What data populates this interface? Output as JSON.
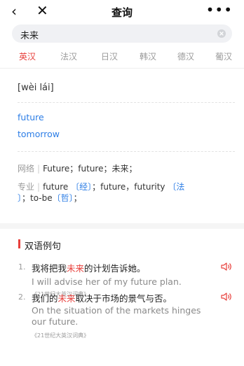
{
  "nav": {
    "back_glyph": "‹",
    "close_glyph": "✕",
    "title": "查询",
    "more_glyph": "•••"
  },
  "search": {
    "value": "未来"
  },
  "tabs": [
    "英汉",
    "法汉",
    "日汉",
    "韩汉",
    "德汉",
    "葡汉"
  ],
  "active_tab": 0,
  "entry": {
    "phonetic": "[wèi lái]",
    "translations": [
      "future",
      "tomorrow"
    ],
    "network": {
      "label": "网络",
      "sep": "|",
      "text": "Future；future；未来；"
    },
    "professional": {
      "label": "专业",
      "sep": "|",
      "part1": "future",
      "tag1": "〔经〕",
      "part2": "；future，futurity",
      "tag2a": "〔法",
      "tag2b": "〕",
      "part3": "；to-be",
      "tag3": "〔哲〕",
      "part4": "；"
    }
  },
  "examples_section": {
    "title": "双语例句",
    "items": [
      {
        "num": "1.",
        "zh_before": "我将把我",
        "zh_hl": "未来",
        "zh_after": "的计划告诉她。",
        "en": "I will advise her of my future plan.",
        "source": "《21世纪大英汉词典》"
      },
      {
        "num": "2.",
        "zh_before": "我们的",
        "zh_hl": "未来",
        "zh_after": "取决于市场的景气与否。",
        "en": "On the situation of the markets hinges our future.",
        "source": "《21世纪大英汉词典》"
      }
    ]
  },
  "colors": {
    "accent": "#e8403c",
    "link": "#2d7ee6",
    "muted": "#9a9a9a"
  }
}
